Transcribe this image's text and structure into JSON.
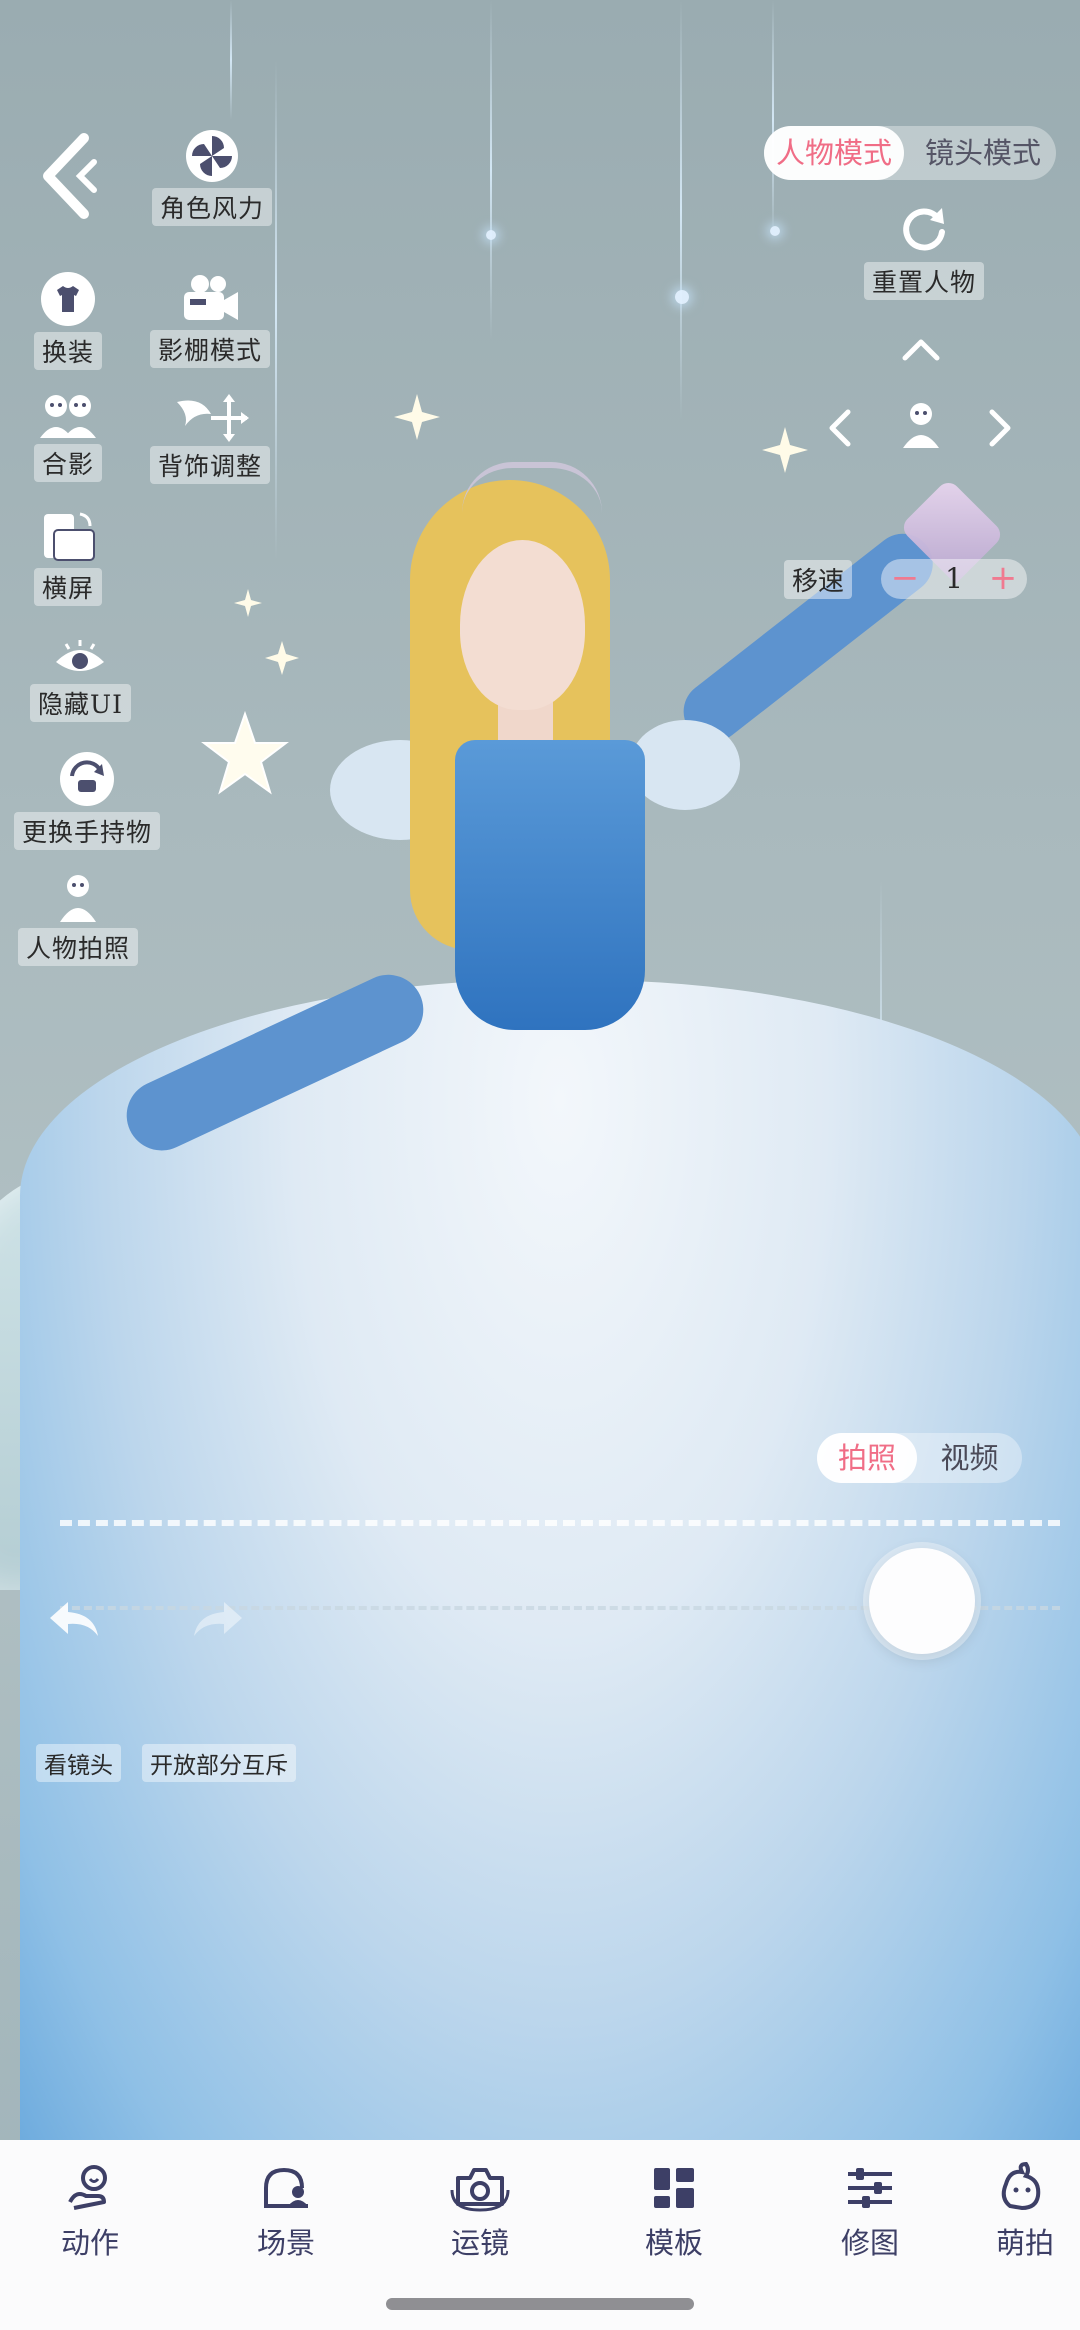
{
  "colors": {
    "accent": "#f06d86",
    "tab_text": "#3d3f66",
    "label_text": "#2a2a2a"
  },
  "left_toolbar": {
    "back_icon": "chevron-left-icon",
    "items": [
      {
        "label": "角色风力",
        "icon": "fan-icon"
      },
      {
        "label": "换装",
        "icon": "outfit-swap-icon"
      },
      {
        "label": "影棚模式",
        "icon": "video-camera-icon"
      },
      {
        "label": "合影",
        "icon": "group-photo-icon"
      },
      {
        "label": "背饰调整",
        "icon": "wing-move-icon"
      },
      {
        "label": "横屏",
        "icon": "landscape-icon"
      },
      {
        "label": "隐藏UI",
        "icon": "eye-icon"
      },
      {
        "label": "更换手持物",
        "icon": "swap-handheld-icon"
      },
      {
        "label": "人物拍照",
        "icon": "person-photo-icon"
      }
    ]
  },
  "mode_toggle": {
    "active": "人物模式",
    "inactive": "镜头模式"
  },
  "reset": {
    "label": "重置人物",
    "icon": "refresh-icon"
  },
  "dpad": {
    "up": "chevron-up-icon",
    "left": "chevron-left-icon",
    "right": "chevron-right-icon",
    "center": "person-icon"
  },
  "speed": {
    "label": "移速",
    "minus": "−",
    "value": "1",
    "plus": "+"
  },
  "capture_toggle": {
    "active": "拍照",
    "inactive": "视频"
  },
  "bottom_left": {
    "undo_icon": "undo-icon",
    "redo_icon": "redo-icon",
    "look_label": "看镜头",
    "interact_label": "开放部分互斥"
  },
  "tabs": [
    {
      "label": "动作",
      "icon": "pose-icon"
    },
    {
      "label": "场景",
      "icon": "scene-icon"
    },
    {
      "label": "运镜",
      "icon": "camera-icon"
    },
    {
      "label": "模板",
      "icon": "template-icon"
    },
    {
      "label": "修图",
      "icon": "adjust-icon"
    },
    {
      "label": "萌拍",
      "icon": "cute-icon"
    }
  ]
}
